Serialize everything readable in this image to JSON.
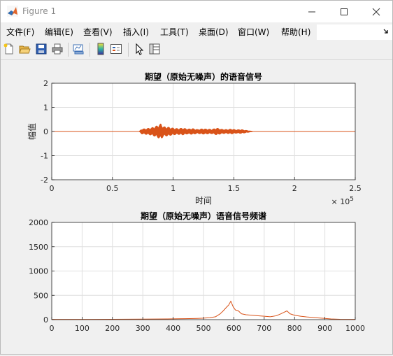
{
  "window": {
    "title": "Figure 1"
  },
  "menu": [
    "文件(F)",
    "编辑(E)",
    "查看(V)",
    "插入(I)",
    "工具(T)",
    "桌面(D)",
    "窗口(W)",
    "帮助(H)"
  ],
  "toolbar_icons": [
    "new-figure-icon",
    "open-file-icon",
    "save-icon",
    "print-icon",
    "link-plot-icon",
    "insert-colorbar-icon",
    "insert-legend-icon",
    "pointer-icon",
    "property-inspector-icon"
  ],
  "colors": {
    "line": "#d95319",
    "axes_bg": "#ffffff",
    "grid": "#dfdfdf",
    "figure_bg": "#f0f0f0"
  },
  "chart_data": [
    {
      "type": "line",
      "title": "期望（原始无噪声）的语音信号",
      "xlabel": "时间",
      "ylabel": "幅值",
      "xlim": [
        0,
        250000
      ],
      "ylim": [
        -2,
        2
      ],
      "x_exponent_label": "× 10",
      "x_exponent_power": "5",
      "xticks": [
        0,
        50000,
        100000,
        150000,
        200000,
        250000
      ],
      "xtick_labels": [
        "0",
        "0.5",
        "1",
        "1.5",
        "2",
        "2.5"
      ],
      "yticks": [
        -2,
        -1,
        0,
        1,
        2
      ],
      "ytick_labels": [
        "-2",
        "-1",
        "0",
        "1",
        "2"
      ],
      "grid": true,
      "series": [
        {
          "x": [
            0,
            72000,
            74000,
            78000,
            82000,
            86000,
            90000,
            92000,
            96000,
            100000,
            104000,
            108000,
            112000,
            116000,
            120000,
            124000,
            128000,
            132000,
            136000,
            140000,
            144000,
            148000,
            152000,
            156000,
            160000,
            166000,
            250000
          ],
          "envelope": [
            0,
            0,
            0.1,
            0.12,
            0.15,
            0.22,
            0.32,
            0.2,
            0.18,
            0.14,
            0.12,
            0.14,
            0.1,
            0.12,
            0.08,
            0.11,
            0.1,
            0.09,
            0.14,
            0.09,
            0.08,
            0.1,
            0.07,
            0.08,
            0.05,
            0,
            0
          ]
        }
      ]
    },
    {
      "type": "line",
      "title": "期望（原始无噪声）语音信号频谱",
      "xlabel": "",
      "ylabel": "",
      "xlim": [
        0,
        1000
      ],
      "ylim": [
        0,
        2000
      ],
      "xticks": [
        0,
        100,
        200,
        300,
        400,
        500,
        600,
        700,
        800,
        900,
        1000
      ],
      "xtick_labels": [
        "0",
        "100",
        "200",
        "300",
        "400",
        "500",
        "600",
        "700",
        "800",
        "900",
        "1000"
      ],
      "yticks": [
        0,
        500,
        1000,
        1500,
        2000
      ],
      "ytick_labels": [
        "0",
        "500",
        "1000",
        "1500",
        "2000"
      ],
      "grid": true,
      "series": [
        {
          "x": [
            0,
            100,
            200,
            300,
            380,
            440,
            480,
            500,
            520,
            540,
            555,
            565,
            575,
            583,
            590,
            598,
            605,
            615,
            625,
            640,
            660,
            680,
            700,
            720,
            740,
            755,
            765,
            775,
            785,
            800,
            820,
            840,
            860,
            880,
            900,
            920,
            950,
            1000
          ],
          "y": [
            5,
            5,
            8,
            10,
            15,
            20,
            25,
            30,
            40,
            60,
            120,
            180,
            250,
            300,
            380,
            260,
            200,
            180,
            120,
            100,
            90,
            80,
            70,
            60,
            80,
            120,
            150,
            180,
            120,
            90,
            70,
            55,
            45,
            35,
            25,
            15,
            8,
            5
          ]
        }
      ]
    }
  ]
}
